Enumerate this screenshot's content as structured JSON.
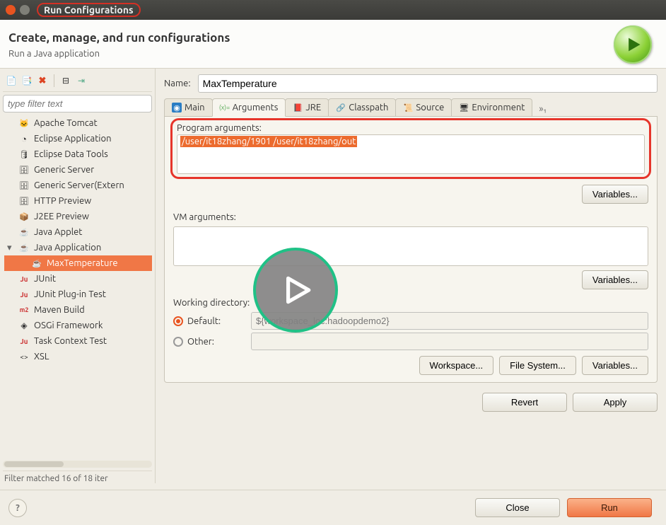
{
  "window": {
    "title": "Run Configurations"
  },
  "header": {
    "title": "Create, manage, and run configurations",
    "subtitle": "Run a Java application"
  },
  "filter": {
    "placeholder": "type filter text"
  },
  "tree": {
    "items": [
      {
        "label": "Apache Tomcat",
        "icon": "tomcat"
      },
      {
        "label": "Eclipse Application",
        "icon": "eclipse"
      },
      {
        "label": "Eclipse Data Tools",
        "icon": "db"
      },
      {
        "label": "Generic Server",
        "icon": "server"
      },
      {
        "label": "Generic Server(Extern",
        "icon": "server"
      },
      {
        "label": "HTTP Preview",
        "icon": "server"
      },
      {
        "label": "J2EE Preview",
        "icon": "j2ee"
      },
      {
        "label": "Java Applet",
        "icon": "applet"
      },
      {
        "label": "Java Application",
        "icon": "java",
        "expanded": true
      },
      {
        "label": "MaxTemperature",
        "icon": "java",
        "child": true,
        "selected": true
      },
      {
        "label": "JUnit",
        "icon": "junit"
      },
      {
        "label": "JUnit Plug-in Test",
        "icon": "junit"
      },
      {
        "label": "Maven Build",
        "icon": "m2"
      },
      {
        "label": "OSGi Framework",
        "icon": "osgi"
      },
      {
        "label": "Task Context Test",
        "icon": "junit"
      },
      {
        "label": "XSL",
        "icon": "xsl"
      }
    ],
    "footer": "Filter matched 16 of 18 iter"
  },
  "name_row": {
    "label": "Name:",
    "value": "MaxTemperature"
  },
  "tabs": [
    {
      "label": "Main",
      "icon": "main"
    },
    {
      "label": "Arguments",
      "icon": "args",
      "active": true
    },
    {
      "label": "JRE",
      "icon": "jre"
    },
    {
      "label": "Classpath",
      "icon": "cp"
    },
    {
      "label": "Source",
      "icon": "src"
    },
    {
      "label": "Environment",
      "icon": "env"
    }
  ],
  "tabs_more": "»₁",
  "args": {
    "program_label": "Program arguments:",
    "program_value": "/user/it18zhang/1901 /user/it18zhang/out",
    "vm_label": "VM arguments:",
    "vm_value": "",
    "variables_label": "Variables..."
  },
  "working_dir": {
    "label": "Working directory:",
    "default_label": "Default:",
    "other_label": "Other:",
    "default_value": "${workspace_loc:hadoopdemo2}",
    "other_value": "",
    "workspace_btn": "Workspace...",
    "filesystem_btn": "File System...",
    "variables_btn": "Variables..."
  },
  "buttons": {
    "revert": "Revert",
    "apply": "Apply",
    "close": "Close",
    "run": "Run"
  }
}
